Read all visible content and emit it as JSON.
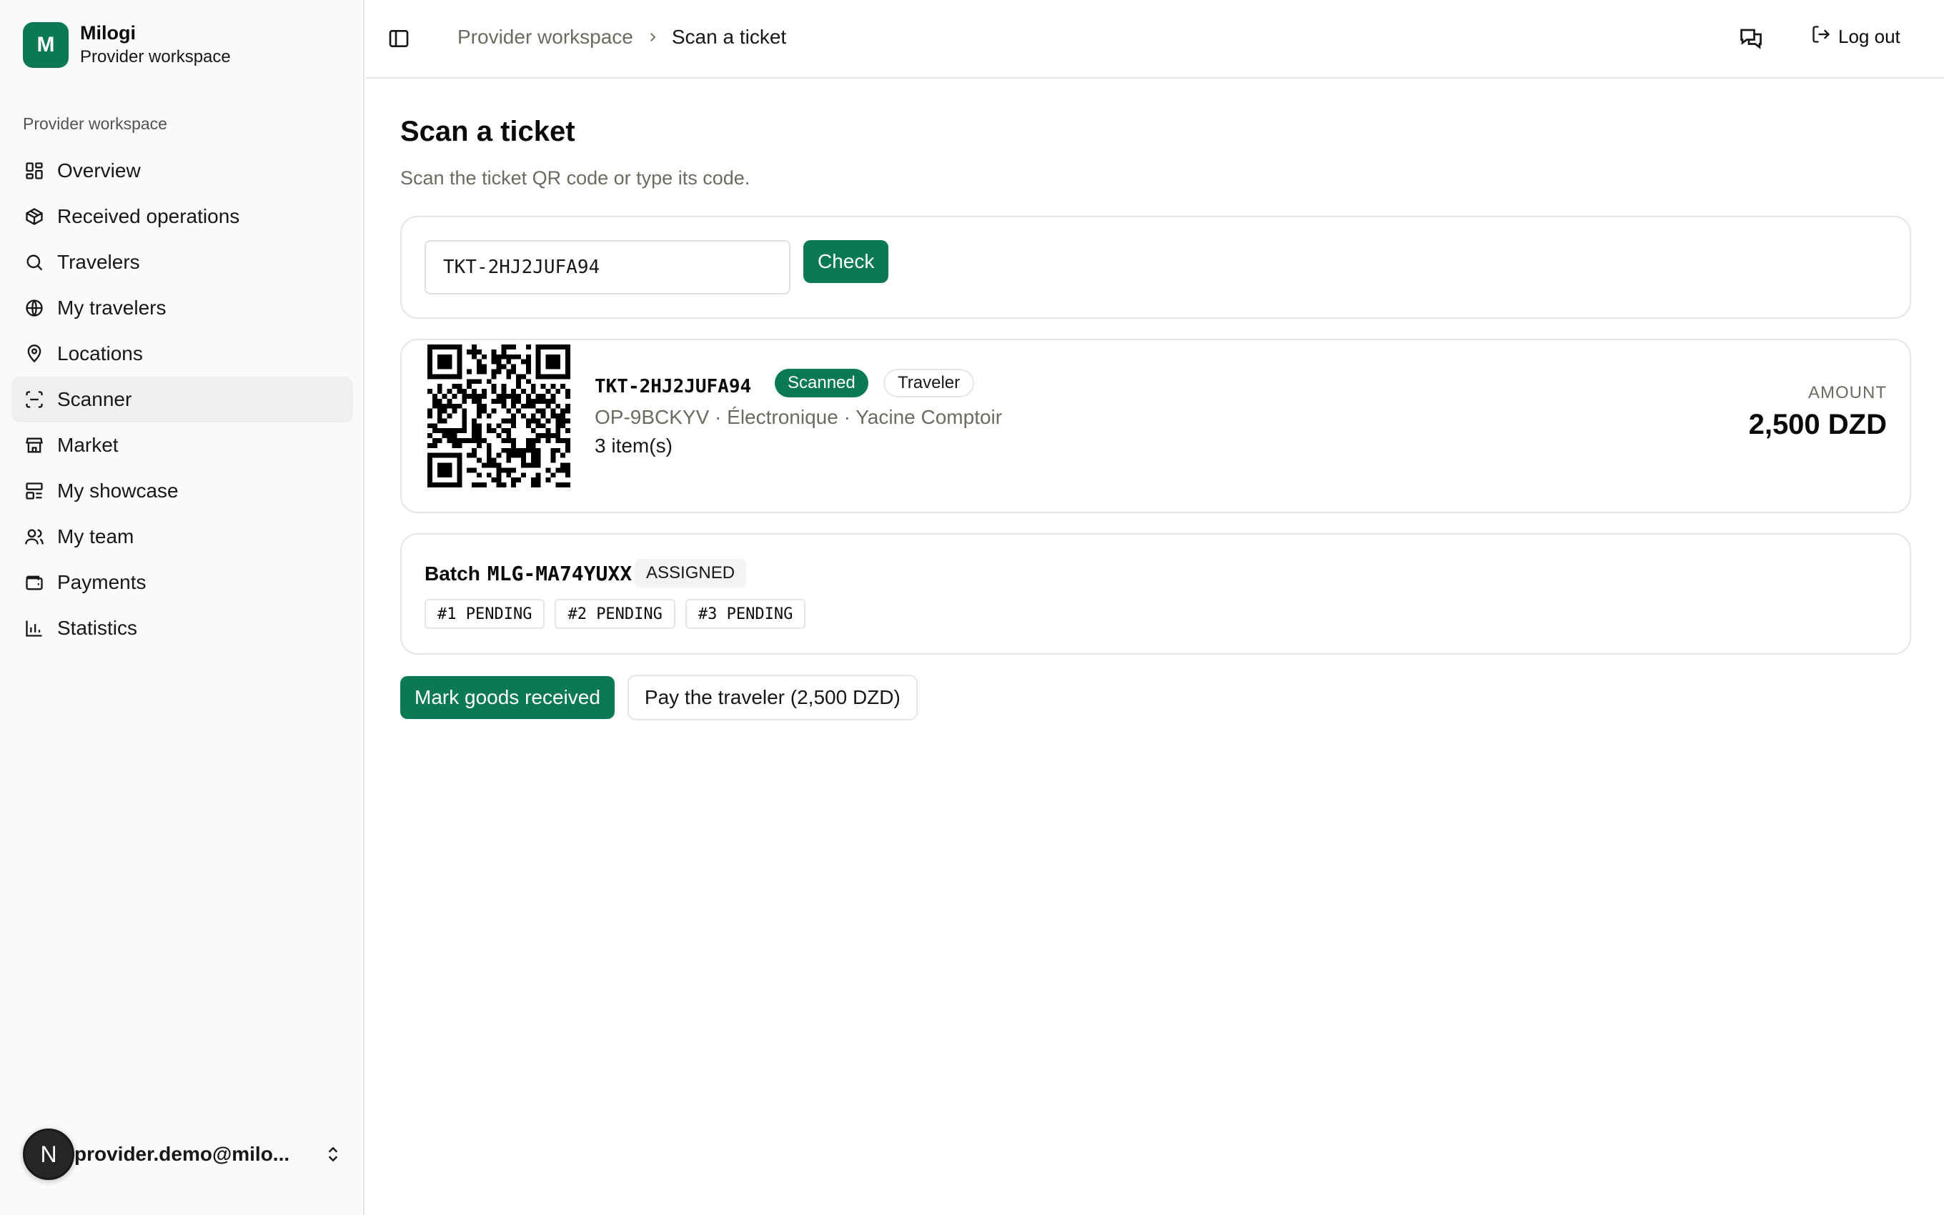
{
  "app": {
    "logo_letter": "M",
    "name": "Milogi",
    "subtitle": "Provider workspace",
    "accent_color": "#0b7a52"
  },
  "sidebar": {
    "group_label": "Provider workspace",
    "items": [
      {
        "label": "Overview",
        "icon": "dashboard-icon"
      },
      {
        "label": "Received operations",
        "icon": "package-icon"
      },
      {
        "label": "Travelers",
        "icon": "search-icon"
      },
      {
        "label": "My travelers",
        "icon": "globe-icon"
      },
      {
        "label": "Locations",
        "icon": "map-pin-icon"
      },
      {
        "label": "Scanner",
        "icon": "scan-icon",
        "active": true
      },
      {
        "label": "Market",
        "icon": "store-icon"
      },
      {
        "label": "My showcase",
        "icon": "layout-icon"
      },
      {
        "label": "My team",
        "icon": "users-icon"
      },
      {
        "label": "Payments",
        "icon": "wallet-icon"
      },
      {
        "label": "Statistics",
        "icon": "bar-chart-icon"
      }
    ],
    "user": {
      "avatar_letter": "N",
      "email": "provider.demo@milo..."
    }
  },
  "header": {
    "breadcrumb": [
      "Provider workspace",
      "Scan a ticket"
    ],
    "logout_label": "Log out"
  },
  "page": {
    "title": "Scan a ticket",
    "subtitle": "Scan the ticket QR code or type its code."
  },
  "search": {
    "value": "TKT-2HJ2JUFA94",
    "button_label": "Check"
  },
  "ticket": {
    "code": "TKT-2HJ2JUFA94",
    "status_badge": "Scanned",
    "type_badge": "Traveler",
    "meta": "OP-9BCKYV · Électronique · Yacine Comptoir",
    "items": "3 item(s)",
    "amount_label": "AMOUNT",
    "amount_value": "2,500 DZD"
  },
  "batch": {
    "label": "Batch",
    "code": "MLG-MA74YUXX",
    "status": "ASSIGNED",
    "pieces": [
      "#1 PENDING",
      "#2 PENDING",
      "#3 PENDING"
    ]
  },
  "actions": {
    "mark_received": "Mark goods received",
    "pay_traveler": "Pay the traveler (2,500 DZD)"
  }
}
